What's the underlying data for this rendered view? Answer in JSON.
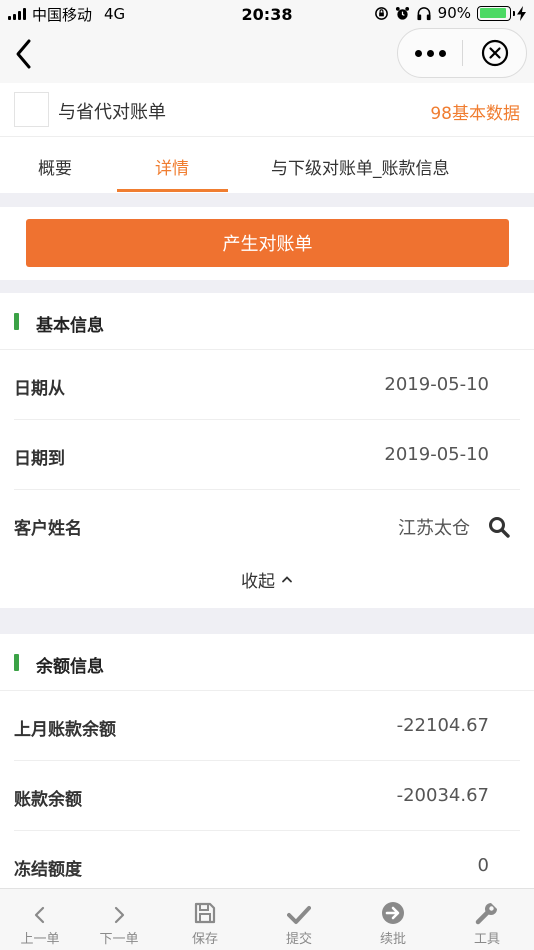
{
  "status": {
    "carrier": "中国移动",
    "network": "4G",
    "time": "20:38",
    "battery": "90%",
    "battery_level": 0.9
  },
  "nav": {
    "back_icon": "chevron-left-icon",
    "more_icon": "more-dots-icon",
    "close_icon": "close-circle-icon"
  },
  "header": {
    "title": "与省代对账单",
    "right_link": "98基本数据"
  },
  "tabs": [
    {
      "label": "概要",
      "active": false
    },
    {
      "label": "详情",
      "active": true
    },
    {
      "label": "与下级对账单_账款信息",
      "active": false
    }
  ],
  "actions": {
    "primary": "产生对账单"
  },
  "basic_info": {
    "title": "基本信息",
    "rows": [
      {
        "label": "日期从",
        "value": "2019-05-10"
      },
      {
        "label": "日期到",
        "value": "2019-05-10"
      },
      {
        "label": "客户姓名",
        "value": "江苏太仓"
      }
    ],
    "collapse_label": "收起"
  },
  "balance_info": {
    "title": "余额信息",
    "rows": [
      {
        "label": "上月账款余额",
        "value": "-22104.67"
      },
      {
        "label": "账款余额",
        "value": "-20034.67"
      },
      {
        "label": "冻结额度",
        "value": "0"
      }
    ]
  },
  "toolbar": [
    {
      "label": "上一单",
      "icon": "chevron-left-icon"
    },
    {
      "label": "下一单",
      "icon": "chevron-right-icon"
    },
    {
      "label": "保存",
      "icon": "save-icon"
    },
    {
      "label": "提交",
      "icon": "check-icon"
    },
    {
      "label": "续批",
      "icon": "arrow-circle-right-icon"
    },
    {
      "label": "工具",
      "icon": "wrench-icon"
    }
  ],
  "colors": {
    "accent": "#f07d30",
    "primary_button": "#ef7230",
    "section_marker": "#3ba246",
    "battery": "#4cd964"
  }
}
